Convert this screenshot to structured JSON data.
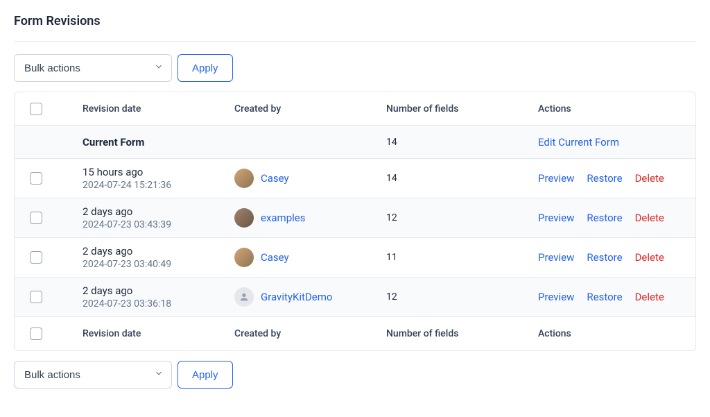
{
  "pageTitle": "Form Revisions",
  "bulk": {
    "selectLabel": "Bulk actions",
    "applyLabel": "Apply"
  },
  "columns": {
    "revisionDate": "Revision date",
    "createdBy": "Created by",
    "numFields": "Number of fields",
    "actions": "Actions"
  },
  "currentRow": {
    "label": "Current Form",
    "numFields": "14",
    "editLabel": "Edit Current Form"
  },
  "rows": [
    {
      "relTime": "15 hours ago",
      "timestamp": "2024-07-24 15:21:36",
      "creator": "Casey",
      "avatarClass": "photo1",
      "avatarType": "photo",
      "numFields": "14"
    },
    {
      "relTime": "2 days ago",
      "timestamp": "2024-07-23 03:43:39",
      "creator": "examples",
      "avatarClass": "photo2",
      "avatarType": "photo",
      "numFields": "12"
    },
    {
      "relTime": "2 days ago",
      "timestamp": "2024-07-23 03:40:49",
      "creator": "Casey",
      "avatarClass": "photo1",
      "avatarType": "photo",
      "numFields": "11"
    },
    {
      "relTime": "2 days ago",
      "timestamp": "2024-07-23 03:36:18",
      "creator": "GravityKitDemo",
      "avatarClass": "placeholder",
      "avatarType": "placeholder",
      "numFields": "12"
    }
  ],
  "actionLabels": {
    "preview": "Preview",
    "restore": "Restore",
    "delete": "Delete"
  }
}
